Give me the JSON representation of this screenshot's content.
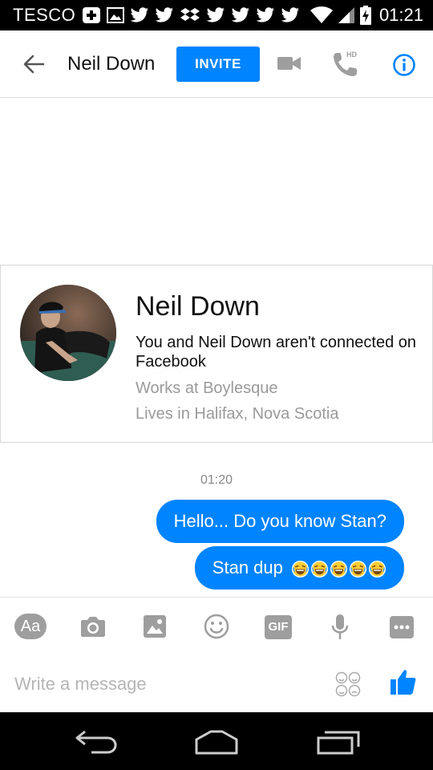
{
  "statusbar": {
    "carrier": "TESCO",
    "time": "01:21"
  },
  "header": {
    "title": "Neil Down",
    "invite_label": "INVITE",
    "hd_badge": "HD"
  },
  "profile": {
    "name": "Neil Down",
    "connection": "You and Neil Down aren't connected on Facebook",
    "work": "Works at Boylesque",
    "lives": "Lives in Halifax, Nova Scotia"
  },
  "messages": {
    "timestamp": "01:20",
    "items": [
      {
        "text": "Hello... Do you know Stan?"
      },
      {
        "text": "Stan dup",
        "emoji_count": 5
      }
    ]
  },
  "composer": {
    "aa_label": "Aa",
    "gif_label": "GIF",
    "placeholder": "Write a message"
  },
  "colors": {
    "accent": "#0084ff",
    "icon_gray": "#9e9e9e"
  }
}
